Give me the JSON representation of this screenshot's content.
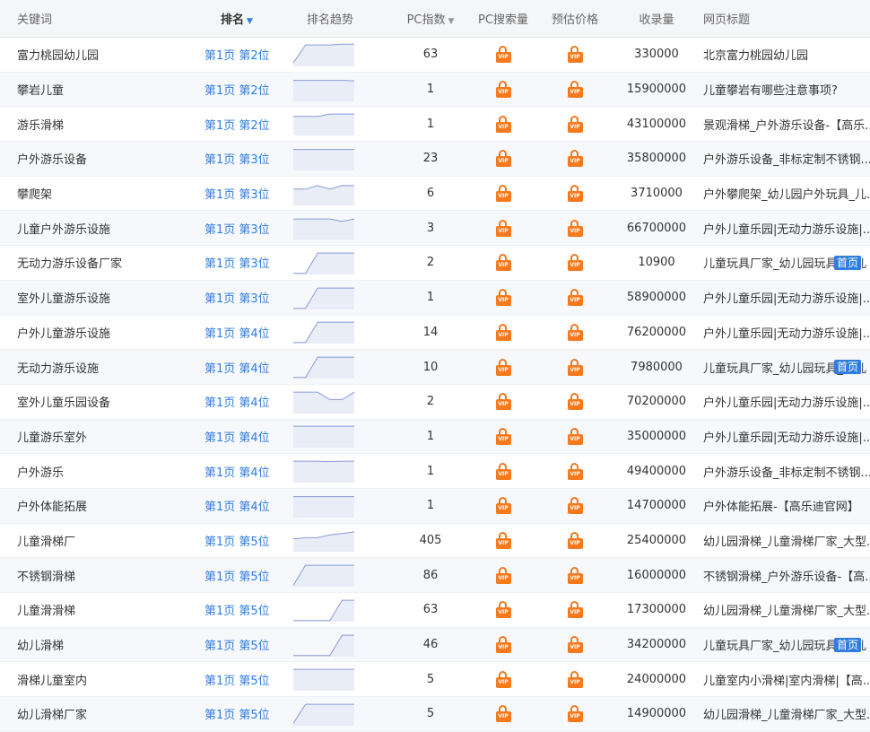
{
  "header": {
    "keyword": "关键词",
    "rank": "排名",
    "trend": "排名趋势",
    "pc_index": "PC指数",
    "pc_search": "PC搜索量",
    "price": "预估价格",
    "count": "收录量",
    "title": "网页标题",
    "sort_arrow": "▼"
  },
  "vip_label": "VIP",
  "rows": [
    {
      "keyword": "富力桃园幼儿园",
      "rank": "第1页 第2位",
      "pc_index": "63",
      "count": "330000",
      "title": "北京富力桃园幼儿园",
      "badge": "",
      "trend": [
        0.15,
        0.92,
        0.92,
        0.92,
        0.95,
        0.95
      ]
    },
    {
      "keyword": "攀岩儿童",
      "rank": "第1页 第2位",
      "pc_index": "1",
      "count": "15900000",
      "title": "儿童攀岩有哪些注意事项?",
      "badge": "",
      "trend": [
        0.9,
        0.9,
        0.9,
        0.9,
        0.9,
        0.88
      ]
    },
    {
      "keyword": "游乐滑梯",
      "rank": "第1页 第2位",
      "pc_index": "1",
      "count": "43100000",
      "title": "景观滑梯_户外游乐设备-【高乐...",
      "badge": "",
      "trend": [
        0.82,
        0.82,
        0.82,
        0.92,
        0.92,
        0.92
      ]
    },
    {
      "keyword": "户外游乐设备",
      "rank": "第1页 第3位",
      "pc_index": "23",
      "count": "35800000",
      "title": "户外游乐设备_非标定制不锈钢...",
      "badge": "",
      "trend": [
        0.9,
        0.9,
        0.9,
        0.9,
        0.9,
        0.9
      ]
    },
    {
      "keyword": "攀爬架",
      "rank": "第1页 第3位",
      "pc_index": "6",
      "count": "3710000",
      "title": "户外攀爬架_幼儿园户外玩具_儿...",
      "badge": "",
      "trend": [
        0.7,
        0.7,
        0.85,
        0.7,
        0.85,
        0.85
      ]
    },
    {
      "keyword": "儿童户外游乐设施",
      "rank": "第1页 第3位",
      "pc_index": "3",
      "count": "66700000",
      "title": "户外儿童乐园|无动力游乐设施|...",
      "badge": "",
      "trend": [
        0.88,
        0.88,
        0.88,
        0.88,
        0.78,
        0.88
      ]
    },
    {
      "keyword": "无动力游乐设备厂家",
      "rank": "第1页 第3位",
      "pc_index": "2",
      "count": "10900",
      "title": "儿童玩具厂家_幼儿园玩具_幼儿",
      "badge": "首页",
      "trend": [
        0.05,
        0.05,
        0.92,
        0.92,
        0.92,
        0.92
      ]
    },
    {
      "keyword": "室外儿童游乐设施",
      "rank": "第1页 第3位",
      "pc_index": "1",
      "count": "58900000",
      "title": "户外儿童乐园|无动力游乐设施|...",
      "badge": "",
      "trend": [
        0.05,
        0.05,
        0.92,
        0.92,
        0.92,
        0.92
      ]
    },
    {
      "keyword": "户外儿童游乐设施",
      "rank": "第1页 第4位",
      "pc_index": "14",
      "count": "76200000",
      "title": "户外儿童乐园|无动力游乐设施|...",
      "badge": "",
      "trend": [
        0.05,
        0.05,
        0.92,
        0.92,
        0.92,
        0.92
      ]
    },
    {
      "keyword": "无动力游乐设施",
      "rank": "第1页 第4位",
      "pc_index": "10",
      "count": "7980000",
      "title": "儿童玩具厂家_幼儿园玩具_幼儿",
      "badge": "首页",
      "trend": [
        0.05,
        0.05,
        0.92,
        0.92,
        0.92,
        0.92
      ]
    },
    {
      "keyword": "室外儿童乐园设备",
      "rank": "第1页 第4位",
      "pc_index": "2",
      "count": "70200000",
      "title": "户外儿童乐园|无动力游乐设施|...",
      "badge": "",
      "trend": [
        0.92,
        0.92,
        0.92,
        0.6,
        0.6,
        0.92
      ]
    },
    {
      "keyword": "儿童游乐室外",
      "rank": "第1页 第4位",
      "pc_index": "1",
      "count": "35000000",
      "title": "户外儿童乐园|无动力游乐设施|...",
      "badge": "",
      "trend": [
        0.92,
        0.92,
        0.92,
        0.92,
        0.92,
        0.92
      ]
    },
    {
      "keyword": "户外游乐",
      "rank": "第1页 第4位",
      "pc_index": "1",
      "count": "49400000",
      "title": "户外游乐设备_非标定制不锈钢...",
      "badge": "",
      "trend": [
        0.92,
        0.92,
        0.92,
        0.9,
        0.92,
        0.92
      ]
    },
    {
      "keyword": "户外体能拓展",
      "rank": "第1页 第4位",
      "pc_index": "1",
      "count": "14700000",
      "title": "户外体能拓展-【高乐迪官网】",
      "badge": "",
      "trend": [
        0.9,
        0.9,
        0.9,
        0.9,
        0.9,
        0.9
      ]
    },
    {
      "keyword": "儿童滑梯厂",
      "rank": "第1页 第5位",
      "pc_index": "405",
      "count": "25400000",
      "title": "幼儿园滑梯_儿童滑梯厂家_大型...",
      "badge": "",
      "trend": [
        0.55,
        0.6,
        0.6,
        0.72,
        0.78,
        0.85
      ]
    },
    {
      "keyword": "不锈钢滑梯",
      "rank": "第1页 第5位",
      "pc_index": "86",
      "count": "16000000",
      "title": "不锈钢滑梯_户外游乐设备-【高...",
      "badge": "",
      "trend": [
        0.05,
        0.92,
        0.92,
        0.92,
        0.92,
        0.92
      ]
    },
    {
      "keyword": "儿童滑滑梯",
      "rank": "第1页 第5位",
      "pc_index": "63",
      "count": "17300000",
      "title": "幼儿园滑梯_儿童滑梯厂家_大型...",
      "badge": "",
      "trend": [
        0.05,
        0.05,
        0.05,
        0.05,
        0.92,
        0.92
      ]
    },
    {
      "keyword": "幼儿滑梯",
      "rank": "第1页 第5位",
      "pc_index": "46",
      "count": "34200000",
      "title": "儿童玩具厂家_幼儿园玩具_幼儿",
      "badge": "首页",
      "trend": [
        0.05,
        0.05,
        0.05,
        0.05,
        0.92,
        0.92
      ]
    },
    {
      "keyword": "滑梯儿童室内",
      "rank": "第1页 第5位",
      "pc_index": "5",
      "count": "24000000",
      "title": "儿童室内小滑梯|室内滑梯|【高...",
      "badge": "",
      "trend": [
        0.92,
        0.92,
        0.92,
        0.92,
        0.92,
        0.92
      ]
    },
    {
      "keyword": "幼儿滑梯厂家",
      "rank": "第1页 第5位",
      "pc_index": "5",
      "count": "14900000",
      "title": "幼儿园滑梯_儿童滑梯厂家_大型...",
      "badge": "",
      "trend": [
        0.1,
        0.92,
        0.92,
        0.92,
        0.92,
        0.92
      ]
    }
  ]
}
